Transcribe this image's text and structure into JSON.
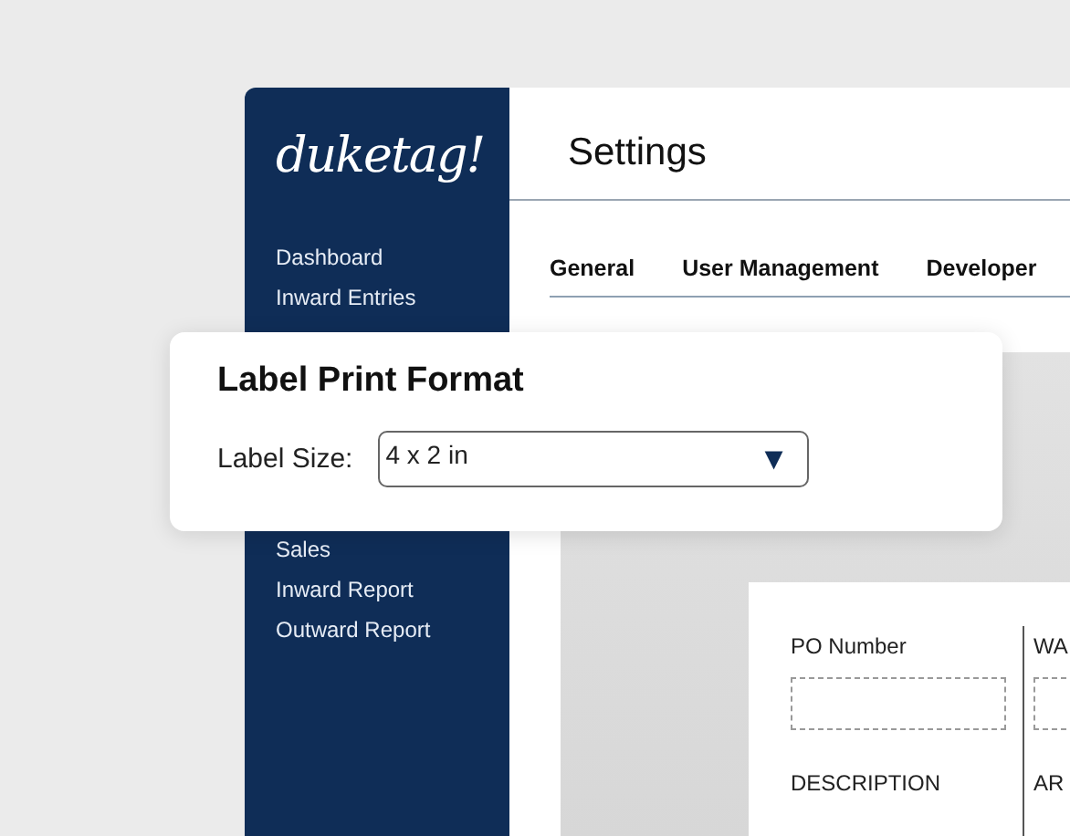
{
  "logo": "duketag!",
  "sidebar": {
    "top_items": [
      "Dashboard",
      "Inward Entries"
    ],
    "bottom_items": [
      "Sales",
      "Inward Report",
      "Outward Report"
    ]
  },
  "header": {
    "title": "Settings"
  },
  "tabs": [
    "General",
    "User Management",
    "Developer"
  ],
  "dialog": {
    "title": "Label Print Format",
    "field_label": "Label Size:",
    "value": "4 x 2 in",
    "caret": "▼"
  },
  "label_preview": {
    "columns": [
      {
        "heading": "PO Number",
        "field_label": "DESCRIPTION"
      },
      {
        "heading": "WA",
        "field_label": "AR"
      }
    ]
  }
}
